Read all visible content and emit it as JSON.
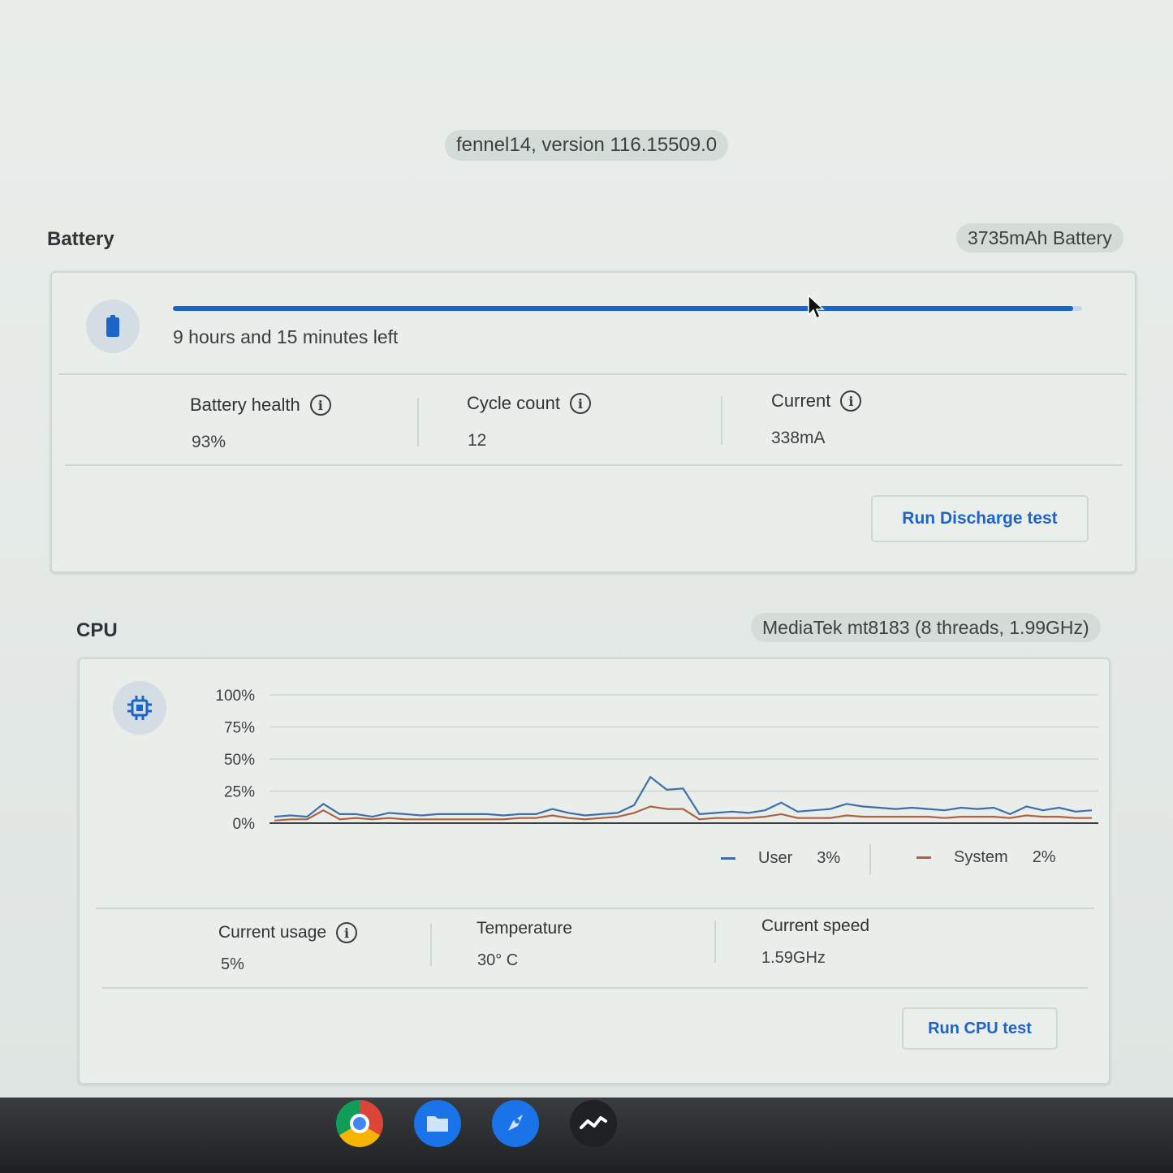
{
  "version": "fennel14, version 116.15509.0",
  "battery": {
    "title": "Battery",
    "capacity": "3735mAh Battery",
    "charge_fraction": 0.99,
    "time_left": "9 hours and 15 minutes left",
    "health_label": "Battery health",
    "health_value": "93%",
    "cycle_label": "Cycle count",
    "cycle_value": "12",
    "current_label": "Current",
    "current_value": "338mA",
    "run_button": "Run Discharge test"
  },
  "cpu": {
    "title": "CPU",
    "model": "MediaTek mt8183 (8 threads, 1.99GHz)",
    "legend": [
      {
        "name": "User",
        "value": "3%",
        "color": "#3f6fa8"
      },
      {
        "name": "System",
        "value": "2%",
        "color": "#b0603f"
      }
    ],
    "usage_label": "Current usage",
    "usage_value": "5%",
    "temp_label": "Temperature",
    "temp_value": "30° C",
    "speed_label": "Current speed",
    "speed_value": "1.59GHz",
    "run_button": "Run CPU test"
  },
  "chart_data": {
    "type": "line",
    "ylim": [
      0,
      100
    ],
    "y_ticks": [
      "100%",
      "75%",
      "50%",
      "25%",
      "0%"
    ],
    "grid": true,
    "legend_position": "bottom-right",
    "series": [
      {
        "name": "User",
        "color": "#3f6fa8",
        "values": [
          5,
          6,
          5,
          15,
          7,
          7,
          5,
          8,
          7,
          6,
          7,
          7,
          7,
          7,
          6,
          7,
          7,
          11,
          8,
          6,
          7,
          8,
          14,
          36,
          26,
          27,
          7,
          8,
          9,
          8,
          10,
          16,
          9,
          10,
          11,
          15,
          13,
          12,
          11,
          12,
          11,
          10,
          12,
          11,
          12,
          7,
          13,
          10,
          12,
          9,
          10
        ]
      },
      {
        "name": "System",
        "color": "#b0603f",
        "values": [
          2,
          3,
          3,
          10,
          3,
          4,
          3,
          4,
          3,
          3,
          3,
          3,
          3,
          3,
          3,
          4,
          4,
          6,
          4,
          3,
          4,
          5,
          8,
          13,
          11,
          11,
          3,
          4,
          4,
          4,
          5,
          7,
          4,
          4,
          4,
          6,
          5,
          5,
          5,
          5,
          5,
          4,
          5,
          5,
          5,
          4,
          6,
          5,
          5,
          4,
          4
        ]
      }
    ]
  },
  "shelf": {
    "apps": [
      "chrome-icon",
      "files-icon",
      "explore-icon",
      "diagnostics-icon"
    ]
  }
}
